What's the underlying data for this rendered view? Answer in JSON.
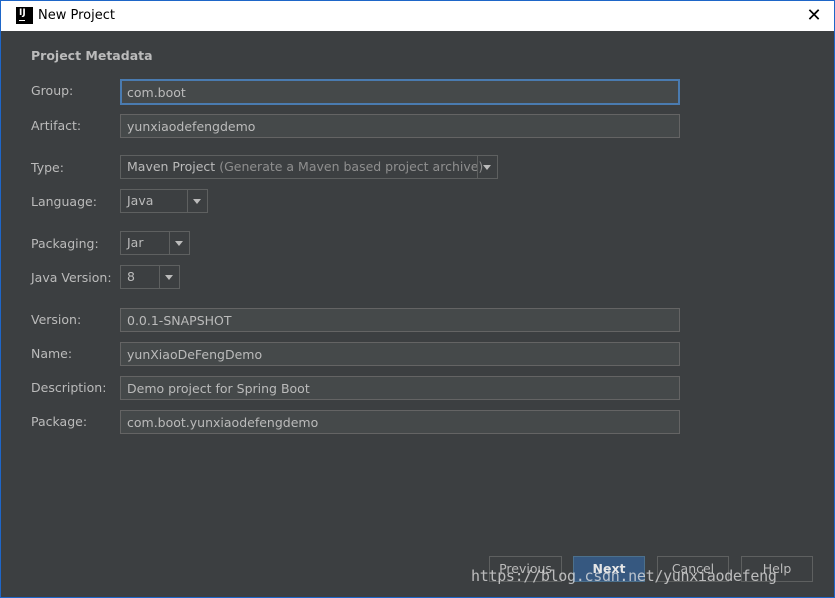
{
  "window": {
    "title": "New Project",
    "app_icon": "intellij-icon",
    "close_icon": "close-icon",
    "close_glyph": "✕"
  },
  "form": {
    "section_title": "Project Metadata",
    "group": {
      "label": "Group:",
      "value": "com.boot"
    },
    "artifact": {
      "label": "Artifact:",
      "value": "yunxiaodefengdemo"
    },
    "type": {
      "label": "Type:",
      "value": "Maven Project",
      "hint": "(Generate a Maven based project archive)"
    },
    "language": {
      "label": "Language:",
      "value": "Java"
    },
    "packaging": {
      "label": "Packaging:",
      "value": "Jar"
    },
    "java_version": {
      "label": "Java Version:",
      "value": "8"
    },
    "version": {
      "label": "Version:",
      "value": "0.0.1-SNAPSHOT"
    },
    "name": {
      "label": "Name:",
      "value": "yunXiaoDeFengDemo"
    },
    "description": {
      "label": "Description:",
      "value": "Demo project for Spring Boot"
    },
    "package": {
      "label": "Package:",
      "value": "com.boot.yunxiaodefengdemo"
    }
  },
  "buttons": {
    "previous": "Previous",
    "next": "Next",
    "cancel": "Cancel",
    "help": "Help"
  },
  "watermark": "https://blog.csdn.net/yunxiaodefeng",
  "colors": {
    "background": "#3c3f41",
    "field_background": "#45494a",
    "focus_border": "#4a7bb0",
    "primary_button": "#365880",
    "text": "#bbbbbb"
  }
}
